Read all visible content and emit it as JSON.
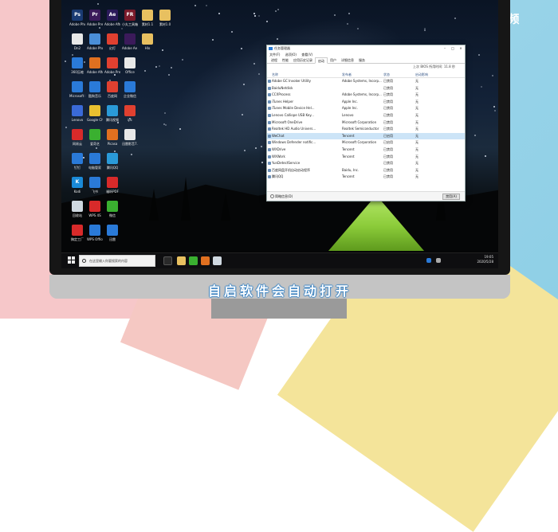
{
  "watermark": "天奇·视频",
  "caption": "自启软件会自动打开",
  "desktop_icons": [
    {
      "label": "Adobe Photosh...",
      "abbr": "Ps",
      "color": "#1a3b73"
    },
    {
      "label": "Adobe Premiere P...",
      "abbr": "Pr",
      "color": "#3b1a5a"
    },
    {
      "label": "Adobe After Effects CC...",
      "abbr": "Ae",
      "color": "#2b1a5a"
    },
    {
      "label": "小丸工具箱",
      "abbr": "FR",
      "color": "#7a1a2a"
    },
    {
      "label": "素材1.1",
      "abbr": "",
      "color": "#e8c060"
    },
    {
      "label": "素材1.0",
      "abbr": "",
      "color": "#e8c060"
    },
    {
      "label": "Dn2",
      "abbr": "",
      "color": "#e8e8e8"
    },
    {
      "label": "Adobe Photosh...",
      "abbr": "",
      "color": "#4a8ed8"
    },
    {
      "label": "幻灯",
      "abbr": "",
      "color": "#e04030"
    },
    {
      "label": "Adobe Ae Creat...",
      "abbr": "",
      "color": "#3b1a5a"
    },
    {
      "label": "Hlo",
      "abbr": "",
      "color": "#e8c060"
    },
    {
      "label": "360压缩",
      "abbr": "",
      "color": "#2a7ad8"
    },
    {
      "label": "Adobe After Effects",
      "abbr": "",
      "color": "#e07020"
    },
    {
      "label": "Adobe Premiere Pro",
      "abbr": "",
      "color": "#e04030"
    },
    {
      "label": "Office",
      "abbr": "",
      "color": "#e8e8e8"
    },
    {
      "label": "Microsoft Edge",
      "abbr": "",
      "color": "#2a7ad8"
    },
    {
      "label": "酷狗音乐",
      "abbr": "",
      "color": "#2a7ad8"
    },
    {
      "label": "百度网",
      "abbr": "",
      "color": "#e04030"
    },
    {
      "label": "企业微信",
      "abbr": "",
      "color": "#2a7ad8"
    },
    {
      "label": "Lenovo",
      "abbr": "",
      "color": "#3a6ad8"
    },
    {
      "label": "Google Chrome",
      "abbr": "",
      "color": "#e8c030"
    },
    {
      "label": "腾讯视频",
      "abbr": "",
      "color": "#2a9ad8"
    },
    {
      "label": "ipc",
      "abbr": "",
      "color": "#e04030"
    },
    {
      "label": "网易云",
      "abbr": "",
      "color": "#d82a2a"
    },
    {
      "label": "爱奇艺",
      "abbr": "",
      "color": "#3ab030"
    },
    {
      "label": "Picasa",
      "abbr": "",
      "color": "#e07020"
    },
    {
      "label": "钉钉",
      "abbr": "",
      "color": "#2a7ad8"
    },
    {
      "label": "电脑管家",
      "abbr": "",
      "color": "#2a7ad8"
    },
    {
      "label": "腾讯QQ",
      "abbr": "",
      "color": "#2a9ad8"
    },
    {
      "label": "迅雷影音7.5",
      "abbr": "",
      "color": "#e8e8e8"
    },
    {
      "label": "Kodi",
      "abbr": "K",
      "color": "#1a8ad8"
    },
    {
      "label": "飞书",
      "abbr": "",
      "color": "#2a7ad8"
    },
    {
      "label": "福昕PDF",
      "abbr": "",
      "color": "#d82a2a"
    },
    {
      "label": "回收站",
      "abbr": "",
      "color": "#cfd8e0"
    },
    {
      "label": "WPS 4S",
      "abbr": "",
      "color": "#d82a2a"
    },
    {
      "label": "微信",
      "abbr": "",
      "color": "#3ab030"
    },
    {
      "label": "稿定工厂",
      "abbr": "",
      "color": "#d82a2a"
    },
    {
      "label": "WPS Office",
      "abbr": "",
      "color": "#2a7ad8"
    },
    {
      "label": "迅雷",
      "abbr": "",
      "color": "#2a7ad8"
    }
  ],
  "taskbar": {
    "search_placeholder": "在这里输入你要搜索的内容",
    "time": "19:05",
    "date": "2020/5/28"
  },
  "task_manager": {
    "title": "任务管理器",
    "menu": [
      "文件(F)",
      "选项(O)",
      "查看(V)"
    ],
    "tabs": [
      "进程",
      "性能",
      "应用历史记录",
      "启动",
      "用户",
      "详细信息",
      "服务"
    ],
    "active_tab": "启动",
    "bios_text": "上次 BIOS 所用时间: 11.8 秒",
    "columns": [
      "名称",
      "发布者",
      "状态",
      "启动影响"
    ],
    "rows": [
      {
        "name": "Adobe GC Invoker Utility",
        "publisher": "Adobe Systems, Incorp...",
        "status": "已禁用",
        "impact": "无"
      },
      {
        "name": "BaiduNetdisk",
        "publisher": "",
        "status": "已禁用",
        "impact": "无"
      },
      {
        "name": "CCXProcess",
        "publisher": "Adobe Systems, Incorp...",
        "status": "已禁用",
        "impact": "无"
      },
      {
        "name": "iTunes Helper",
        "publisher": "Apple Inc.",
        "status": "已禁用",
        "impact": "无"
      },
      {
        "name": "iTunes Mobile Device Hel...",
        "publisher": "Apple Inc.",
        "status": "已禁用",
        "impact": "无"
      },
      {
        "name": "Lenovo Calliope USB Key...",
        "publisher": "Lenovo",
        "status": "已禁用",
        "impact": "无"
      },
      {
        "name": "Microsoft OneDrive",
        "publisher": "Microsoft Corporation",
        "status": "已禁用",
        "impact": "无"
      },
      {
        "name": "Realtek HD Audio Univers...",
        "publisher": "Realtek Semiconductor",
        "status": "已禁用",
        "impact": "无"
      },
      {
        "name": "WeChat",
        "publisher": "Tencent",
        "status": "已启用",
        "impact": "无"
      },
      {
        "name": "Windows Defender notific...",
        "publisher": "Microsoft Corporation",
        "status": "已启用",
        "impact": "无"
      },
      {
        "name": "WXDrive",
        "publisher": "Tencent",
        "status": "已禁用",
        "impact": "无"
      },
      {
        "name": "WXWork",
        "publisher": "Tencent",
        "status": "已禁用",
        "impact": "无"
      },
      {
        "name": "YunDetectService",
        "publisher": "",
        "status": "已禁用",
        "impact": "无"
      },
      {
        "name": "百度网盘开机自动启动程序",
        "publisher": "Baidu, Inc.",
        "status": "已禁用",
        "impact": "无"
      },
      {
        "name": "腾讯QQ",
        "publisher": "Tencent",
        "status": "已禁用",
        "impact": "无"
      }
    ],
    "selected_row": 8,
    "fewer_details": "简略信息(D)",
    "disable_button": "禁用(A)"
  }
}
